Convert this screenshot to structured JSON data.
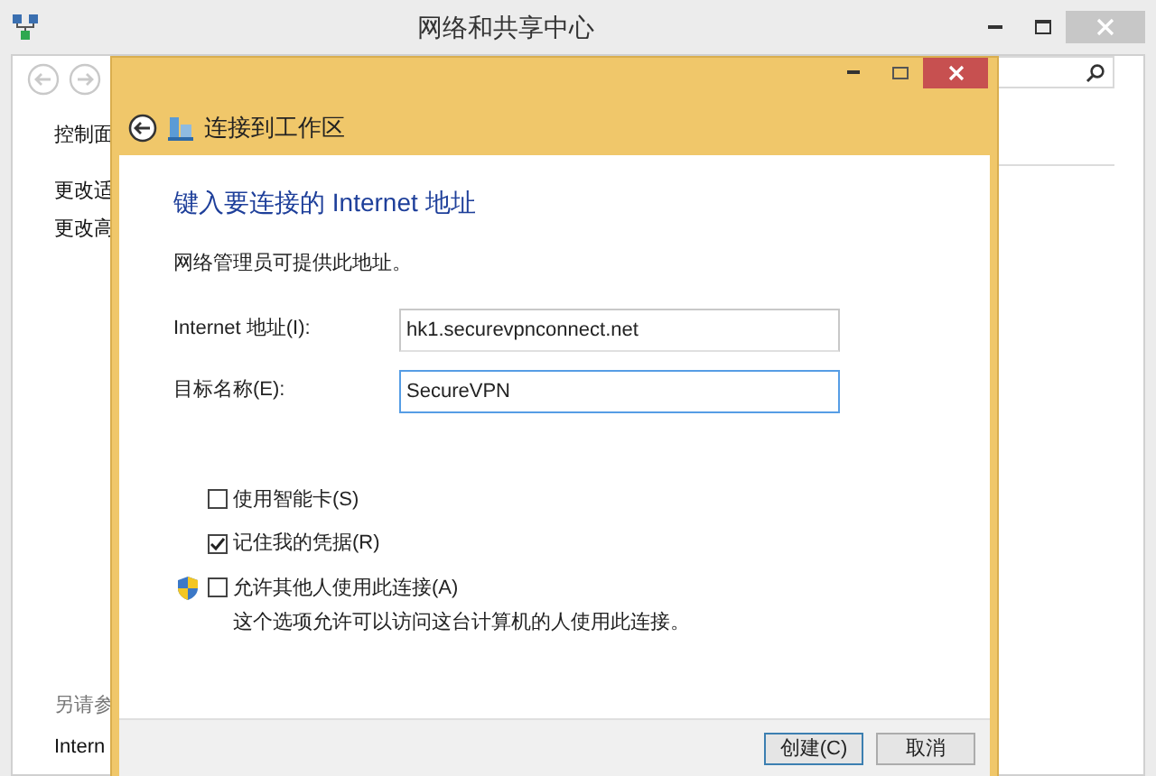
{
  "window": {
    "title": "网络和共享中心"
  },
  "sidebar": {
    "items": [
      "控制面",
      "更改适",
      "更改高"
    ],
    "see_also_title": "另请参",
    "see_also_items": [
      "Intern"
    ]
  },
  "dialog": {
    "title": "连接到工作区",
    "heading": "键入要连接的 Internet 地址",
    "hint": "网络管理员可提供此地址。",
    "fields": [
      {
        "label": "Internet 地址(I):",
        "value": "hk1.securevpnconnect.net",
        "focused": false
      },
      {
        "label": "目标名称(E):",
        "value": "SecureVPN",
        "focused": true
      }
    ],
    "options": [
      {
        "label": "使用智能卡(S)",
        "checked": false,
        "shield": false
      },
      {
        "label": "记住我的凭据(R)",
        "checked": true,
        "shield": false
      },
      {
        "label": "允许其他人使用此连接(A)",
        "checked": false,
        "shield": true,
        "description": "这个选项允许可以访问这台计算机的人使用此连接。"
      }
    ],
    "buttons": [
      {
        "label": "创建(C)",
        "default": true
      },
      {
        "label": "取消",
        "default": false
      }
    ]
  }
}
